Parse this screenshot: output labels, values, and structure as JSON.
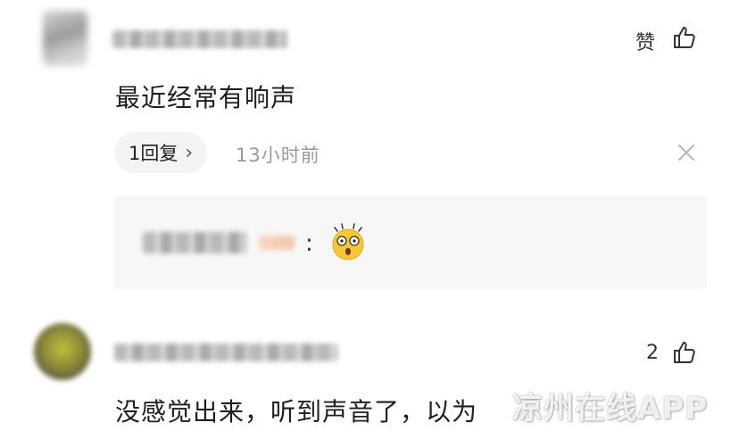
{
  "comment1": {
    "text": "最近经常有响声",
    "like_label": "赞",
    "replies_label": "1回复",
    "reply_chevron": "›",
    "time": "13小时前",
    "reply": {
      "separator": ":",
      "emoji_icon": "astonished-face-emoji"
    }
  },
  "comment2": {
    "text": "没感觉出来，听到声音了，以为",
    "like_count": "2"
  },
  "watermark": {
    "text": "凉州在线APP"
  },
  "icons": {
    "like": "thumbs-up-icon",
    "close": "close-icon"
  }
}
